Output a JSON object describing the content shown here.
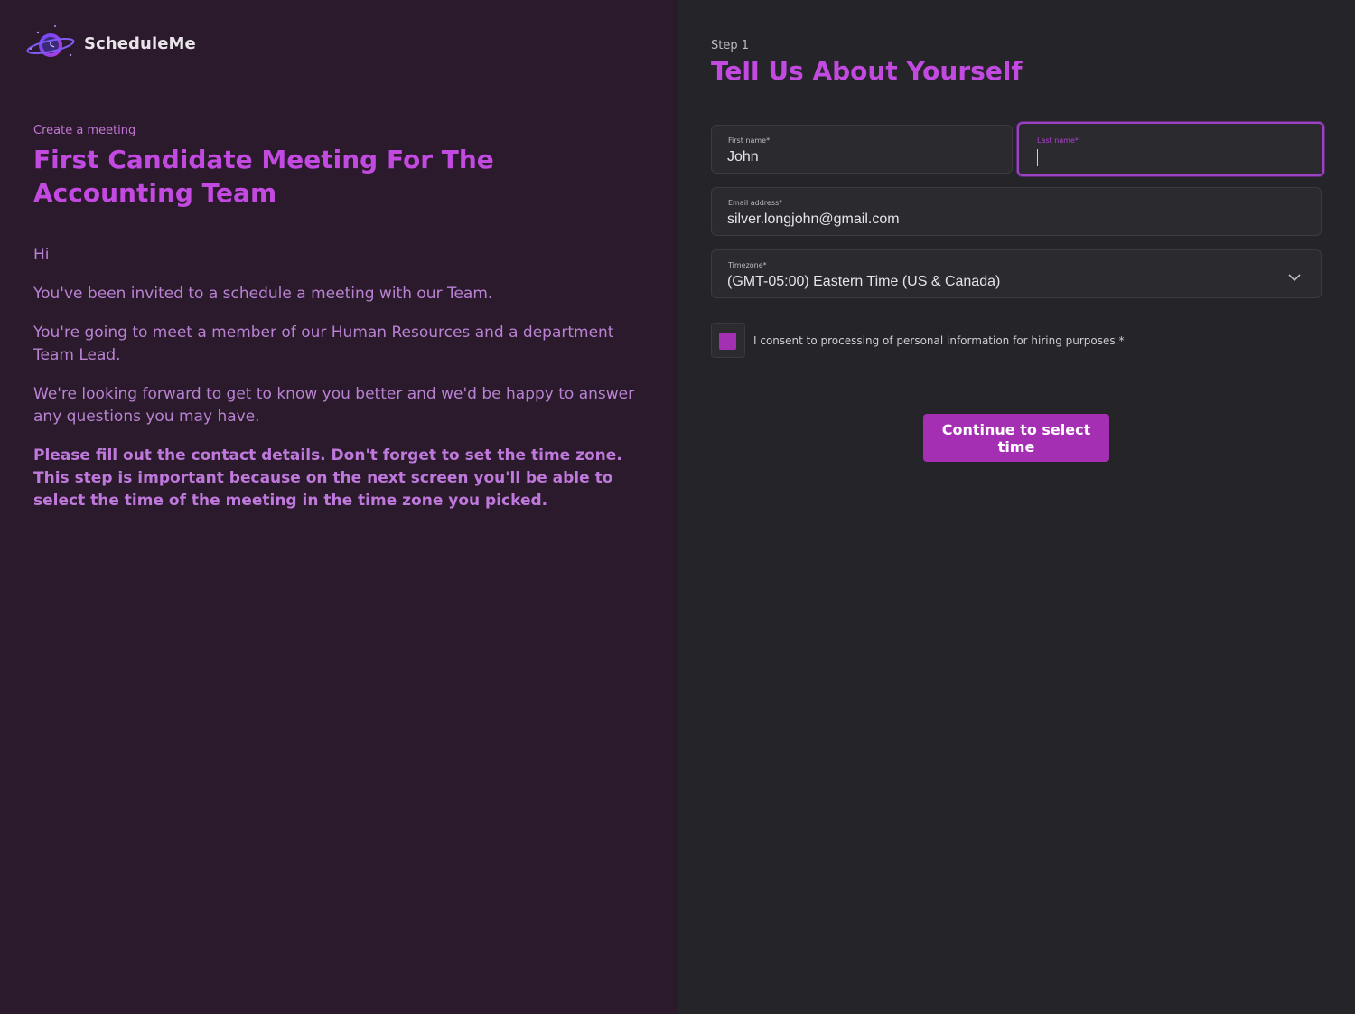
{
  "brand": {
    "name": "ScheduleMe",
    "logo_icon": "planet-clock-logo"
  },
  "meeting": {
    "label": "Create a meeting",
    "title": "First Candidate Meeting For The Accounting Team",
    "paragraphs": [
      "Hi",
      "You've been invited to a schedule a meeting with our Team.",
      "You're going to meet a member of our Human Resources and a department Team Lead.",
      "We're looking forward to get to know you better and we'd be happy to answer any questions you may have."
    ],
    "instructions": "Please fill out the contact details. Don't forget to set the time zone. This step is important because on the next screen you'll be able to select the time of the meeting in the time zone you picked."
  },
  "form": {
    "step_label": "Step 1",
    "title": "Tell Us About Yourself",
    "first_name": {
      "label": "First name*",
      "value": "John"
    },
    "last_name": {
      "label": "Last name*",
      "value": ""
    },
    "email": {
      "label": "Email address*",
      "value": "silver.longjohn@gmail.com"
    },
    "timezone": {
      "label": "Timezone*",
      "value": "(GMT-05:00) Eastern Time (US & Canada)",
      "icon": "chevron-down-icon"
    },
    "consent": {
      "label": "I consent to processing of personal information for hiring purposes.*",
      "checked": true
    },
    "submit_label": "Continue to select time"
  },
  "colors": {
    "left_bg": "#2a1a2c",
    "right_bg": "#252428",
    "accent": "#c24ae0",
    "button": "#a52fb3",
    "focus_border": "#9b43c4"
  }
}
